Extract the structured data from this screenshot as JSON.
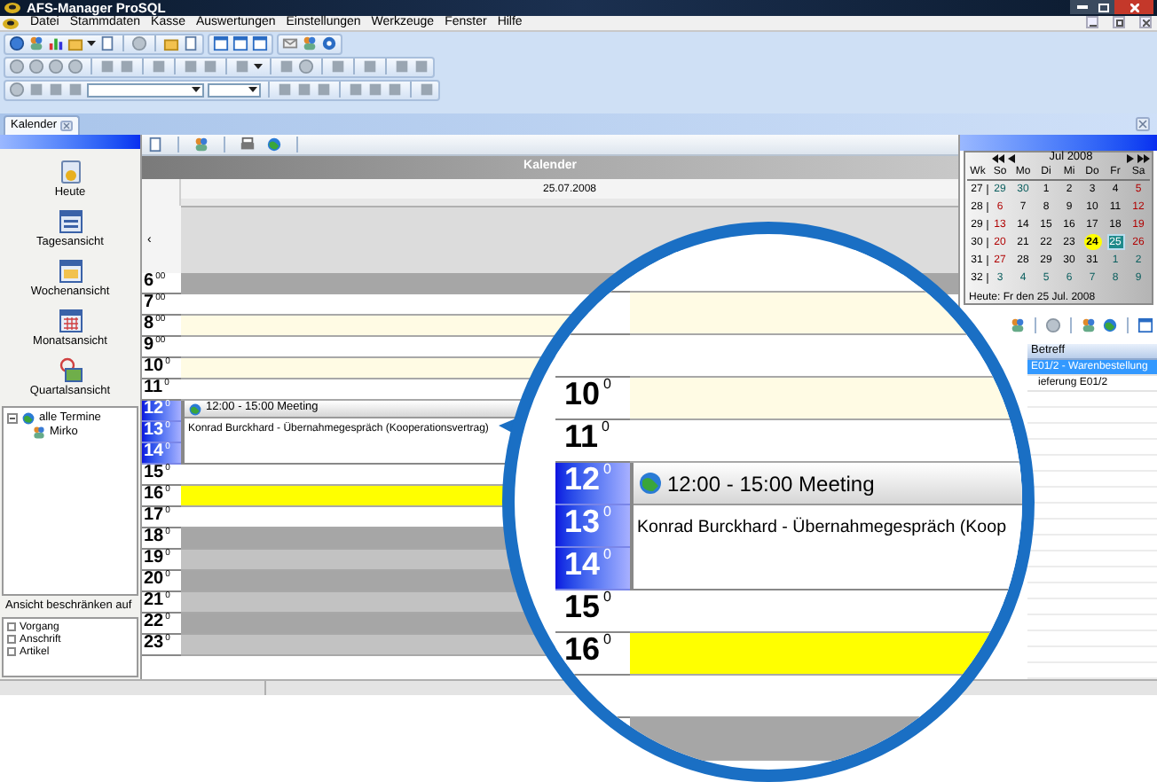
{
  "window": {
    "title": "AFS-Manager ProSQL"
  },
  "menu": [
    "Datei",
    "Stammdaten",
    "Kasse",
    "Auswertungen",
    "Einstellungen",
    "Werkzeuge",
    "Fenster",
    "Hilfe"
  ],
  "document_tabs": [
    {
      "label": "Kalender",
      "selected": true
    }
  ],
  "sidebar": {
    "nav": [
      {
        "label": "Heute",
        "kind": "today"
      },
      {
        "label": "Tagesansicht",
        "kind": "day"
      },
      {
        "label": "Wochenansicht",
        "kind": "week"
      },
      {
        "label": "Monatsansicht",
        "kind": "month"
      },
      {
        "label": "Quartalsansicht",
        "kind": "quarter"
      }
    ],
    "tree": [
      {
        "label": "alle Termine",
        "expanded": true,
        "children": [
          {
            "label": "Mirko"
          }
        ]
      }
    ],
    "filter_title": "Ansicht beschränken auf",
    "filters": [
      {
        "label": "Vorgang",
        "checked": false
      },
      {
        "label": "Anschrift",
        "checked": false
      },
      {
        "label": "Artikel",
        "checked": false
      }
    ]
  },
  "calendar": {
    "title": "Kalender",
    "date": "25.07.2008",
    "nav": "‹",
    "hours": [
      {
        "hour": "6",
        "minutes": "00",
        "kind": "dark",
        "selected": false
      },
      {
        "hour": "7",
        "minutes": "00",
        "kind": "white",
        "selected": false
      },
      {
        "hour": "8",
        "minutes": "00",
        "kind": "cream",
        "selected": false
      },
      {
        "hour": "9",
        "minutes": "00",
        "kind": "white",
        "selected": false
      },
      {
        "hour": "10",
        "minutes": "0",
        "kind": "cream",
        "selected": false
      },
      {
        "hour": "11",
        "minutes": "0",
        "kind": "white",
        "selected": false
      },
      {
        "hour": "12",
        "minutes": "0",
        "selected": true
      },
      {
        "hour": "13",
        "minutes": "0",
        "selected": true
      },
      {
        "hour": "14",
        "minutes": "0",
        "selected": true
      },
      {
        "hour": "15",
        "minutes": "0",
        "kind": "white",
        "selected": false
      },
      {
        "hour": "16",
        "minutes": "0",
        "kind": "yellow",
        "selected": false
      },
      {
        "hour": "17",
        "minutes": "0",
        "kind": "white",
        "selected": false
      },
      {
        "hour": "18",
        "minutes": "0",
        "kind": "dark",
        "selected": false
      },
      {
        "hour": "19",
        "minutes": "0",
        "kind": "light",
        "selected": false
      },
      {
        "hour": "20",
        "minutes": "0",
        "kind": "dark",
        "selected": false
      },
      {
        "hour": "21",
        "minutes": "0",
        "kind": "light",
        "selected": false
      },
      {
        "hour": "22",
        "minutes": "0",
        "kind": "dark",
        "selected": false
      },
      {
        "hour": "23",
        "minutes": "0",
        "kind": "light",
        "selected": false
      }
    ],
    "event": {
      "time": "12:00 - 15:00 Meeting",
      "text": "Konrad Burckhard - Übernahmegespräch (Kooperationsvertrag)"
    }
  },
  "mini_calendar": {
    "month": "Jul 2008",
    "weekdays": [
      "Wk",
      "So",
      "Mo",
      "Di",
      "Mi",
      "Do",
      "Fr",
      "Sa"
    ],
    "weeks": [
      {
        "week": "27",
        "days": [
          {
            "day": "29",
            "kind": "other"
          },
          {
            "day": "30",
            "kind": "other"
          },
          {
            "day": "1",
            "kind": "normal"
          },
          {
            "day": "2",
            "kind": "normal"
          },
          {
            "day": "3",
            "kind": "normal"
          },
          {
            "day": "4",
            "kind": "normal"
          },
          {
            "day": "5",
            "kind": "weekend"
          }
        ]
      },
      {
        "week": "28",
        "days": [
          {
            "day": "6",
            "kind": "weekend"
          },
          {
            "day": "7",
            "kind": "normal"
          },
          {
            "day": "8",
            "kind": "normal"
          },
          {
            "day": "9",
            "kind": "normal"
          },
          {
            "day": "10",
            "kind": "normal"
          },
          {
            "day": "11",
            "kind": "normal"
          },
          {
            "day": "12",
            "kind": "weekend"
          }
        ]
      },
      {
        "week": "29",
        "days": [
          {
            "day": "13",
            "kind": "weekend"
          },
          {
            "day": "14",
            "kind": "normal"
          },
          {
            "day": "15",
            "kind": "normal"
          },
          {
            "day": "16",
            "kind": "normal"
          },
          {
            "day": "17",
            "kind": "normal"
          },
          {
            "day": "18",
            "kind": "normal"
          },
          {
            "day": "19",
            "kind": "weekend"
          }
        ]
      },
      {
        "week": "30",
        "days": [
          {
            "day": "20",
            "kind": "weekend"
          },
          {
            "day": "21",
            "kind": "normal"
          },
          {
            "day": "22",
            "kind": "normal"
          },
          {
            "day": "23",
            "kind": "normal"
          },
          {
            "day": "24",
            "kind": "marked"
          },
          {
            "day": "25",
            "kind": "today"
          },
          {
            "day": "26",
            "kind": "weekend"
          }
        ]
      },
      {
        "week": "31",
        "days": [
          {
            "day": "27",
            "kind": "weekend"
          },
          {
            "day": "28",
            "kind": "normal"
          },
          {
            "day": "29",
            "kind": "normal"
          },
          {
            "day": "30",
            "kind": "normal"
          },
          {
            "day": "31",
            "kind": "normal"
          },
          {
            "day": "1",
            "kind": "other"
          },
          {
            "day": "2",
            "kind": "other"
          }
        ]
      },
      {
        "week": "32",
        "days": [
          {
            "day": "3",
            "kind": "other"
          },
          {
            "day": "4",
            "kind": "other"
          },
          {
            "day": "5",
            "kind": "other"
          },
          {
            "day": "6",
            "kind": "other"
          },
          {
            "day": "7",
            "kind": "other"
          },
          {
            "day": "8",
            "kind": "other"
          },
          {
            "day": "9",
            "kind": "other"
          }
        ]
      }
    ],
    "today_label": "Heute: Fr den 25 Jul. 2008"
  },
  "list": {
    "columns": [
      "Betreff"
    ],
    "rows": [
      {
        "subject": "E01/2 - Warenbestellung",
        "selected": true
      },
      {
        "subject": "ieferung E01/2",
        "selected": false
      }
    ]
  },
  "magnifier": {
    "hours": [
      {
        "kind": "white"
      },
      {
        "kind": "cream"
      },
      {
        "kind": "white"
      },
      {
        "hour": "10",
        "minutes": "0",
        "kind": "cream",
        "selected": false
      },
      {
        "hour": "11",
        "minutes": "0",
        "kind": "white",
        "selected": false
      },
      {
        "hour": "12",
        "minutes": "0",
        "selected": true
      },
      {
        "hour": "13",
        "minutes": "0",
        "selected": true
      },
      {
        "hour": "14",
        "minutes": "0",
        "selected": true
      },
      {
        "hour": "15",
        "minutes": "0",
        "kind": "white",
        "selected": false
      },
      {
        "hour": "16",
        "minutes": "0",
        "kind": "yellow",
        "selected": false
      },
      {
        "kind": "white"
      },
      {
        "kind": "dark"
      }
    ],
    "event": {
      "time": "12:00 - 15:00 Meeting",
      "text": "Konrad Burckhard - Übernahmegespräch (Koop"
    }
  }
}
